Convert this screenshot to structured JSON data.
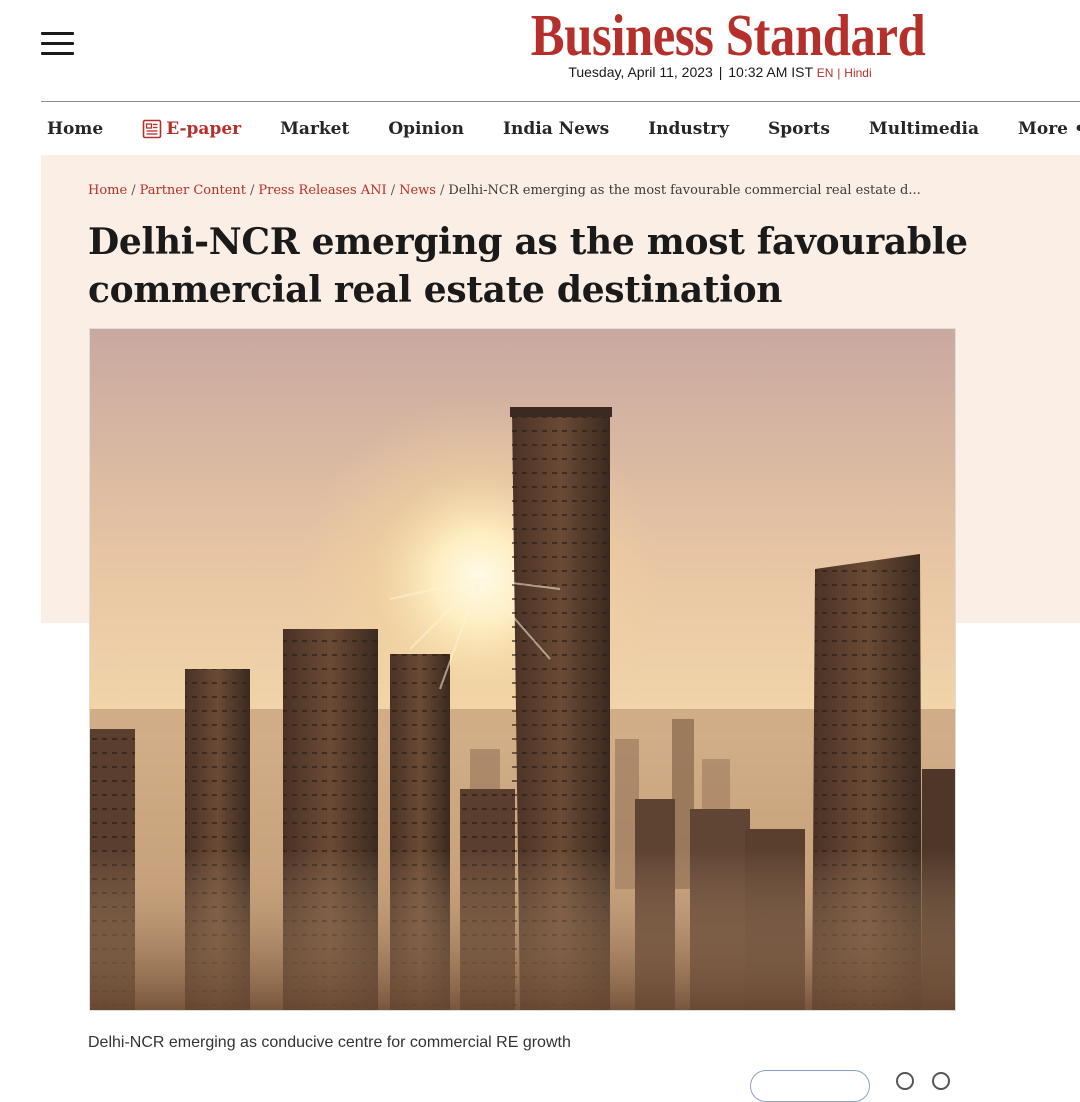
{
  "header": {
    "logo": "Business Standard",
    "date": "Tuesday, April 11, 2023",
    "time": "10:32 AM IST",
    "lang_en": "EN",
    "lang_hindi": "Hindi",
    "brand_color": "#b5302a"
  },
  "nav": {
    "items": [
      {
        "label": "Home"
      },
      {
        "label": "E-paper",
        "icon": "newspaper-icon"
      },
      {
        "label": "Market"
      },
      {
        "label": "Opinion"
      },
      {
        "label": "India News"
      },
      {
        "label": "Industry"
      },
      {
        "label": "Sports"
      },
      {
        "label": "Multimedia"
      },
      {
        "label": "More"
      }
    ]
  },
  "breadcrumb": {
    "items": [
      "Home",
      "Partner Content",
      "Press Releases ANI",
      "News"
    ],
    "current": "Delhi-NCR emerging as the most favourable commercial real estate d..."
  },
  "article": {
    "headline": "Delhi-NCR emerging as the most favourable commercial real estate destination",
    "image_alt": "City skyline with high-rise towers at sunrise",
    "caption": "Delhi-NCR emerging as conducive centre for commercial RE growth"
  },
  "colors": {
    "band": "#fbeee5",
    "accent": "#b5302a"
  }
}
